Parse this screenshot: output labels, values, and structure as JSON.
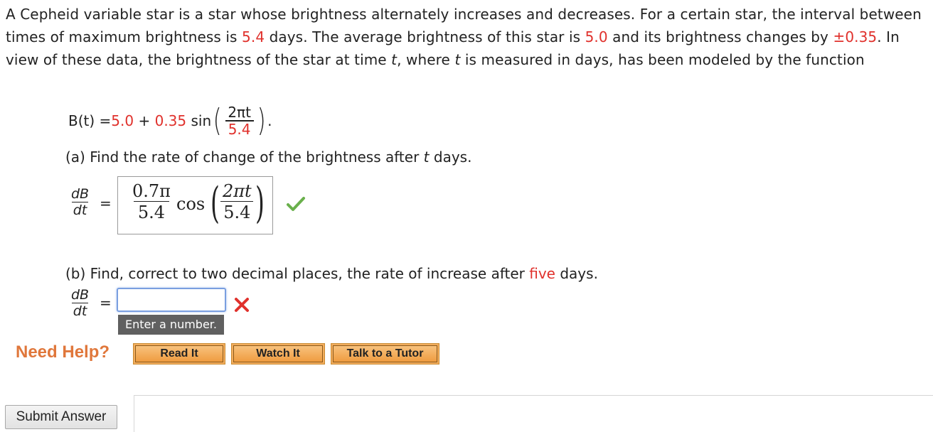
{
  "problem": {
    "intro_1": "A Cepheid variable star is a star whose brightness alternately increases and decreases. For a certain star, the interval between times of maximum brightness is ",
    "period": "5.4",
    "intro_2": " days. The average brightness of this star is ",
    "average": "5.0",
    "intro_3": " and its brightness changes by ",
    "change": "±0.35",
    "intro_4": ". In view of these data, the brightness of the star at time ",
    "t1": "t",
    "intro_5": ", where ",
    "t2": "t",
    "intro_6": " is measured in days, has been modeled by the function"
  },
  "formula": {
    "lhs": "B(t) = ",
    "a": "5.0",
    "plus": " + ",
    "b": "0.35",
    "sin": " sin",
    "num": "2πt",
    "den": "5.4",
    "end": "."
  },
  "part_a": {
    "question_1": "(a) Find the rate of change of the brightness after ",
    "question_t": "t",
    "question_2": " days.",
    "deriv_top": "dB",
    "deriv_bottom": "dt",
    "equals": "=",
    "answer": {
      "coef_num": "0.7π",
      "coef_den": "5.4",
      "func": "cos",
      "arg_num": "2πt",
      "arg_den": "5.4"
    },
    "status": "correct",
    "status_color": "#6ab04c"
  },
  "part_b": {
    "question_1": "(b) Find, correct to two decimal places, the rate of increase after ",
    "question_days": "five",
    "question_2": " days.",
    "deriv_top": "dB",
    "deriv_bottom": "dt",
    "equals": "=",
    "input_value": "",
    "tooltip": "Enter a number.",
    "status": "incorrect",
    "status_color": "#e0312c"
  },
  "help": {
    "label": "Need Help?",
    "buttons": [
      "Read It",
      "Watch It",
      "Talk to a Tutor"
    ]
  },
  "submit_label": "Submit Answer",
  "colors": {
    "accent_red": "#e0312c",
    "help_orange": "#e0773b",
    "button_orange": "#f3ad5e",
    "input_border": "#7a9fe0"
  }
}
